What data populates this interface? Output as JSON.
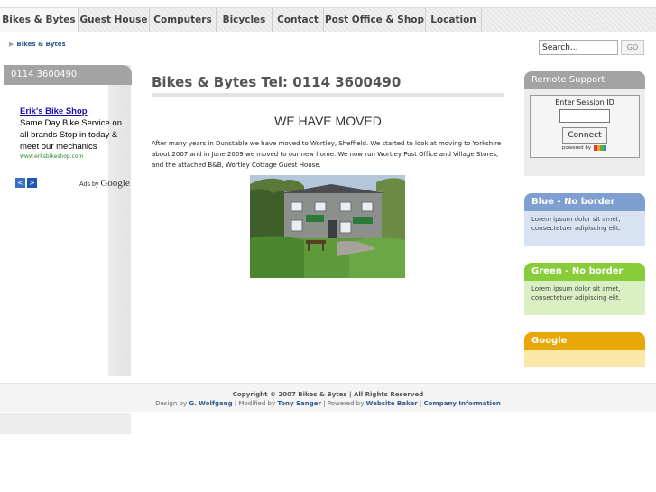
{
  "nav": {
    "items": [
      {
        "label": "Bikes & Bytes"
      },
      {
        "label": "Guest House"
      },
      {
        "label": "Computers"
      },
      {
        "label": "Bicycles"
      },
      {
        "label": "Contact"
      },
      {
        "label": "Post Office & Shop"
      },
      {
        "label": "Location"
      }
    ]
  },
  "breadcrumb": {
    "arrow": "▶",
    "label": "Bikes & Bytes"
  },
  "search": {
    "value": "Search...",
    "button": "GO"
  },
  "left": {
    "phone": "0114 3600490",
    "ad": {
      "title": "Erik's Bike Shop",
      "text": "Same Day Bike Service on all brands Stop in today & meet our mechanics",
      "url": "www.erksbikeshop.com"
    },
    "prev": "<",
    "next": ">",
    "ads_by": "Ads by",
    "ads_by_brand": "Google"
  },
  "main": {
    "title": "Bikes & Bytes Tel: 0114 3600490",
    "heading": "WE HAVE MOVED",
    "body": "After many years in Dunstable we have moved to Wortley, Sheffield. We started to look at moving to Yorkshire about 2007 and in June 2009 we moved to our new home. We now run Wortley Post Office and Village Stores, and the attached B&B, Wortley Cottage Guest House."
  },
  "right": {
    "remote": {
      "title": "Remote Support",
      "label": "Enter Session ID",
      "button": "Connect",
      "powered": "powered by"
    },
    "blue": {
      "title": "Blue - No border",
      "text": "Lorem ipsum dolor sit amet, consectetuer adipiscing elit."
    },
    "green": {
      "title": "Green - No border",
      "text": "Lorem ipsum dolor sit amet, consectetuer adipiscing elit."
    },
    "google": {
      "title": "Google"
    }
  },
  "footer": {
    "copyright": "Copyright © 2007 Bikes & Bytes | All Rights Reserved",
    "design_by": "Design by",
    "designer": "G. Wolfgang",
    "modified_by": "Modified by",
    "modifier": "Tony Sanger",
    "powered_by": "Powered by",
    "powered": "Website Baker",
    "company": "Company Information"
  },
  "colors": {
    "nav_text": "#444444",
    "link_blue": "#2f5a8a",
    "box_blue": "#7f9fd0",
    "box_green": "#88cd39",
    "box_google": "#e8a80a"
  }
}
